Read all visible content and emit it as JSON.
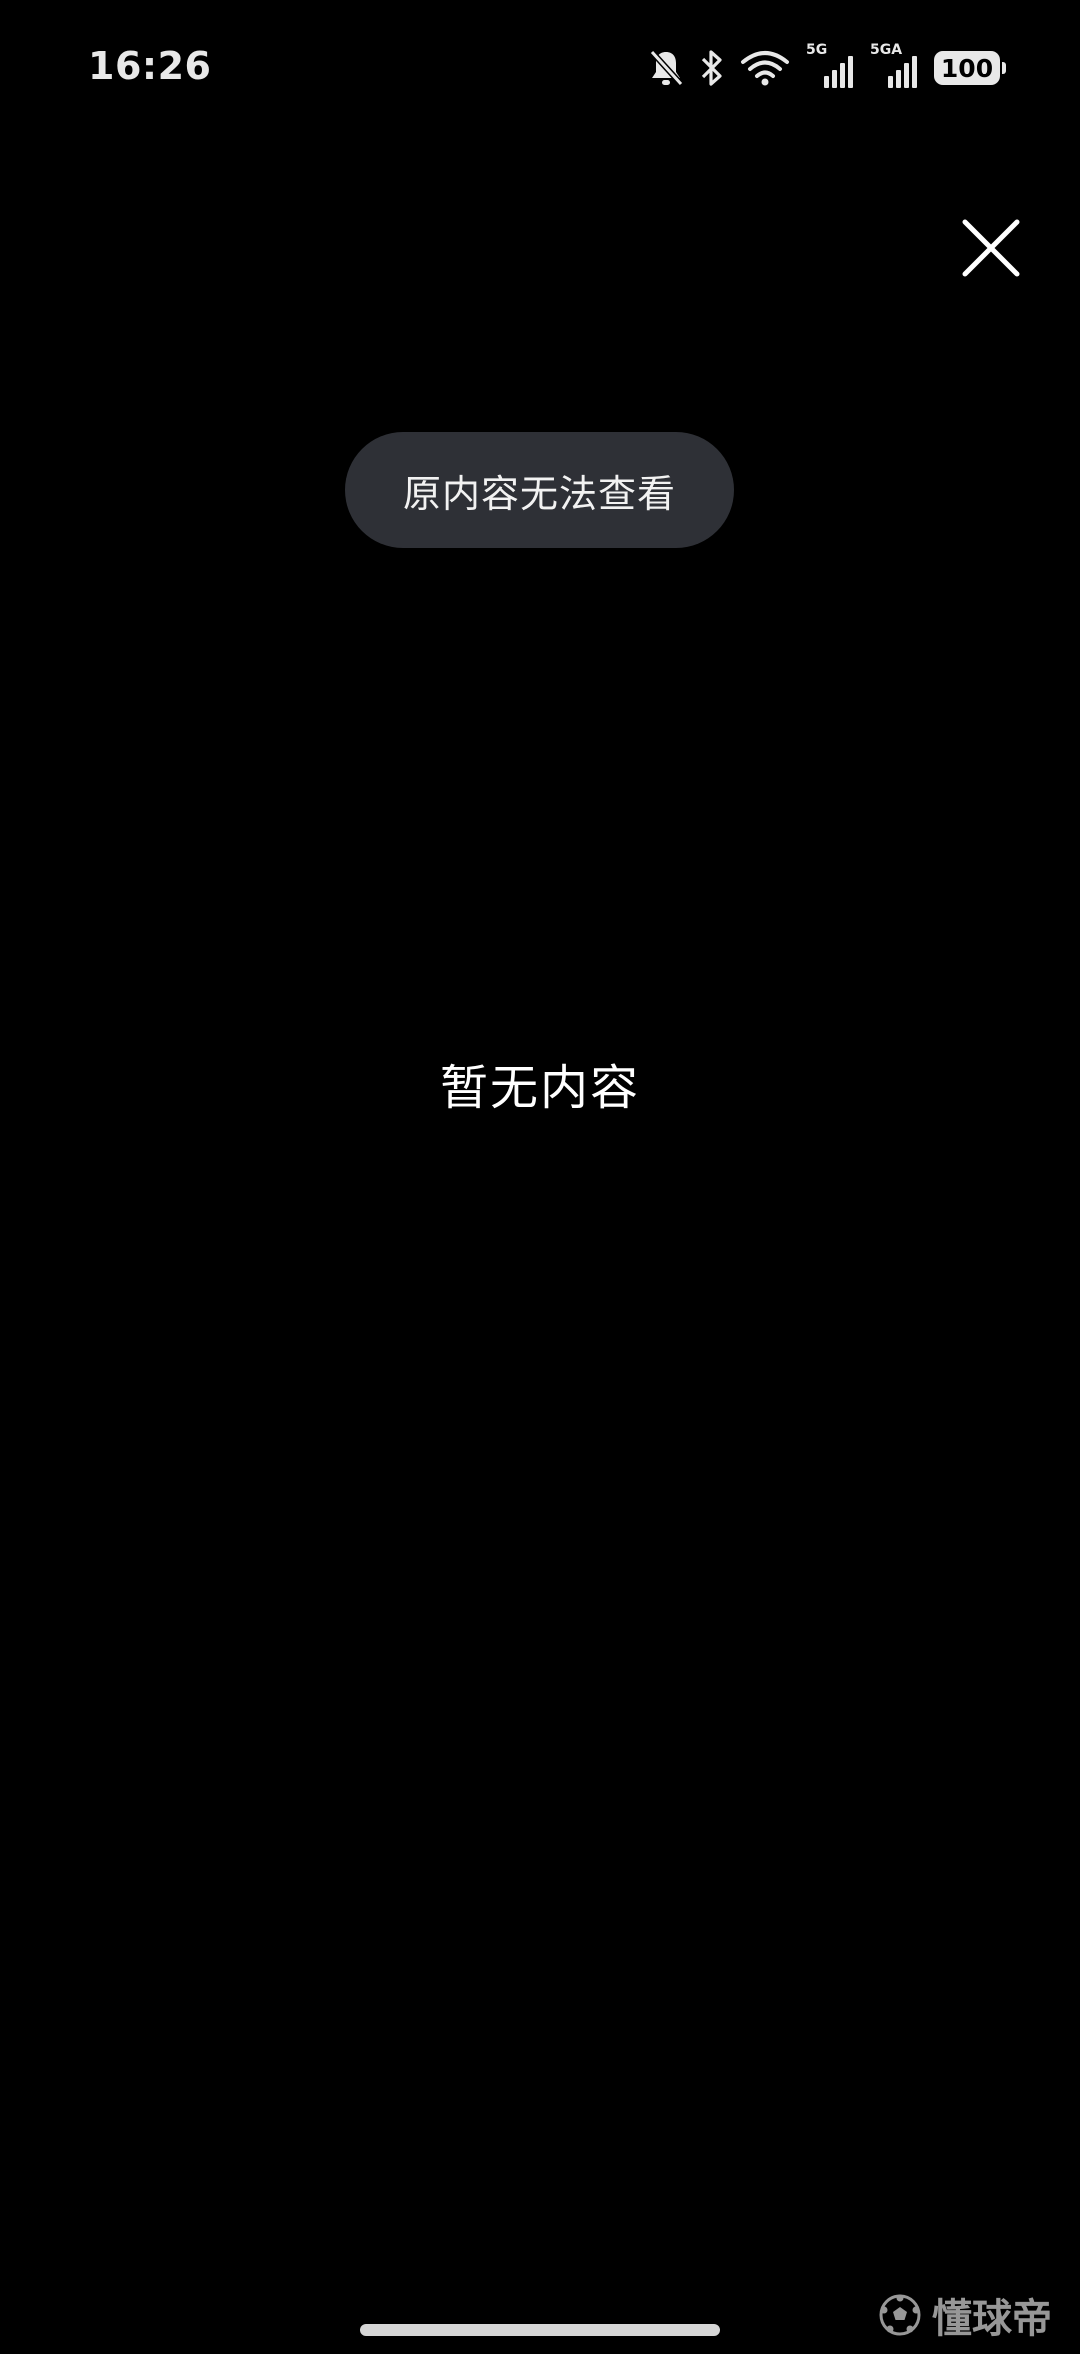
{
  "status_bar": {
    "time": "16:26",
    "icons": [
      "bell-muted-icon",
      "bluetooth-icon",
      "wifi-icon",
      "signal-5g-icon",
      "signal-5ga-icon",
      "battery-icon"
    ],
    "sim1_label": "5G",
    "sim2_label": "5GA",
    "battery_level": "100"
  },
  "close_button": {
    "icon": "close-icon"
  },
  "toast": {
    "text": "原内容无法查看"
  },
  "main": {
    "empty_text": "暂无内容"
  },
  "watermark": {
    "icon": "soccer-ball-icon",
    "text": "懂球帝"
  },
  "colors": {
    "background": "#000000",
    "toast_background": "#2e3036",
    "text": "#ffffff"
  }
}
